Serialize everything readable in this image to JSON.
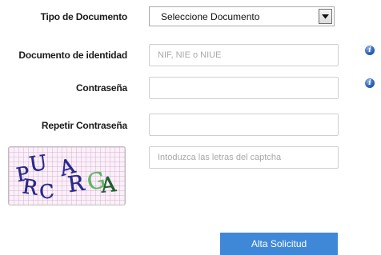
{
  "form": {
    "document_type": {
      "label": "Tipo de Documento",
      "selected": "Seleccione Documento"
    },
    "identity_document": {
      "label": "Documento de identidad",
      "placeholder": "NIF, NIE o NIUE",
      "value": ""
    },
    "password": {
      "label": "Contraseña",
      "value": ""
    },
    "repeat_password": {
      "label": "Repetir Contraseña",
      "value": ""
    },
    "captcha": {
      "image_text": "PRUCARGA",
      "input_placeholder": "Intoduzca las letras del captcha",
      "value": ""
    },
    "submit_label": "Alta Solicitud"
  },
  "icons": {
    "info": "info-icon",
    "dropdown": "chevron-down-icon"
  },
  "colors": {
    "submit_background": "#3f88d8",
    "info_icon": "#2f63b8",
    "captcha_background": "#fbf0f8",
    "captcha_letters": "#2a2a8a",
    "captcha_letter_shadow": "#4caf50"
  }
}
